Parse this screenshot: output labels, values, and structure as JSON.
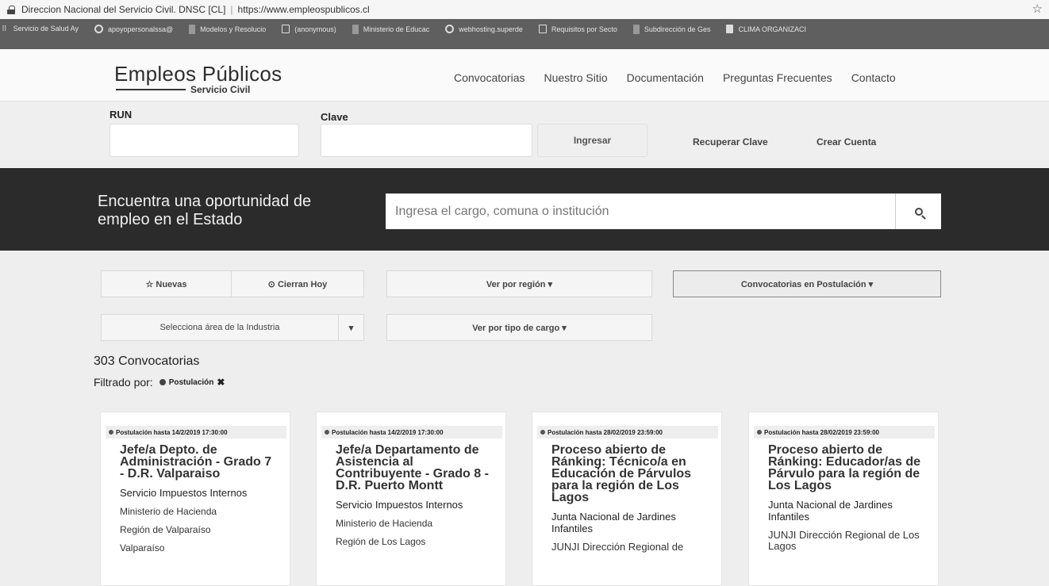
{
  "browser": {
    "site_label": "Direccion Nacional del Servicio Civil. DNSC [CL]",
    "url": "https://www.empleospublicos.cl",
    "bookmarks": [
      {
        "label": "Servicio de Salud Ay",
        "icon": "page-icon"
      },
      {
        "label": "apoyopersonalssa@",
        "icon": "google-icon"
      },
      {
        "label": "Modelos y Resolucio",
        "icon": "folder-icon"
      },
      {
        "label": "(anonymous)",
        "icon": "page-icon"
      },
      {
        "label": "Ministerio de Educac",
        "icon": "folder-icon"
      },
      {
        "label": "webhosting.superde",
        "icon": "globe-icon"
      },
      {
        "label": "Requisitos por Secto",
        "icon": "page-icon"
      },
      {
        "label": "Subdirección de Ges",
        "icon": "folder-icon"
      },
      {
        "label": "CLIMA ORGANIZACI",
        "icon": "blogger-icon"
      }
    ]
  },
  "header": {
    "logo_title": "Empleos Públicos",
    "logo_subtitle": "Servicio Civil",
    "nav": [
      "Convocatorias",
      "Nuestro Sitio",
      "Documentación",
      "Preguntas Frecuentes",
      "Contacto"
    ]
  },
  "login": {
    "run_label": "RUN",
    "run_value": "",
    "clave_label": "Clave",
    "clave_value": "",
    "ingresar": "Ingresar",
    "recuperar": "Recuperar Clave",
    "crear": "Crear Cuenta"
  },
  "hero": {
    "title": "Encuentra una oportunidad de empleo en el Estado",
    "search_placeholder": "Ingresa el cargo, comuna o institución"
  },
  "filters": {
    "nuevas": "☆ Nuevas",
    "cierran_hoy": "⊙ Cierran Hoy",
    "ver_region": "Ver por región ▾",
    "convocatorias_postulacion": "Convocatorias en Postulación ▾",
    "area_industria": "Selecciona área de la Industria",
    "area_caret": "▾",
    "ver_tipo_cargo": "Ver por tipo de cargo ▾"
  },
  "results": {
    "count": "303 Convocatorias",
    "filtered_label": "Filtrado por:",
    "filter_tag": "Postulación",
    "remove": "✖"
  },
  "cards": [
    {
      "badge": "Postulación hasta 14/2/2019 17:30:00",
      "title": "Jefe/a Depto. de Administración - Grado 7 - D.R. Valparaiso",
      "line1": "Servicio Impuestos Internos",
      "line2": "Ministerio de Hacienda",
      "line3": "Región de Valparaíso",
      "line4": "Valparaíso"
    },
    {
      "badge": "Postulación hasta 14/2/2019 17:30:00",
      "title": "Jefe/a Departamento de Asistencia al Contribuyente - Grado 8 - D.R. Puerto Montt",
      "line1": "Servicio Impuestos Internos",
      "line2": "Ministerio de Hacienda",
      "line3": "Región de Los Lagos",
      "line4": ""
    },
    {
      "badge": "Postulación hasta 28/02/2019 23:59:00",
      "title": "Proceso abierto de Ránking: Técnico/a en Educación de Párvulos para la región de Los Lagos",
      "line1": "Junta Nacional de Jardines Infantiles",
      "line2": "JUNJI Dirección Regional de",
      "line3": "",
      "line4": ""
    },
    {
      "badge": "Postulación hasta 28/02/2019 23:59:00",
      "title": "Proceso abierto de Ránking: Educador/as de Párvulo para la región de Los Lagos",
      "line1": "Junta Nacional de Jardines Infantiles",
      "line2": "JUNJI Dirección Regional de Los Lagos",
      "line3": "",
      "line4": ""
    }
  ]
}
